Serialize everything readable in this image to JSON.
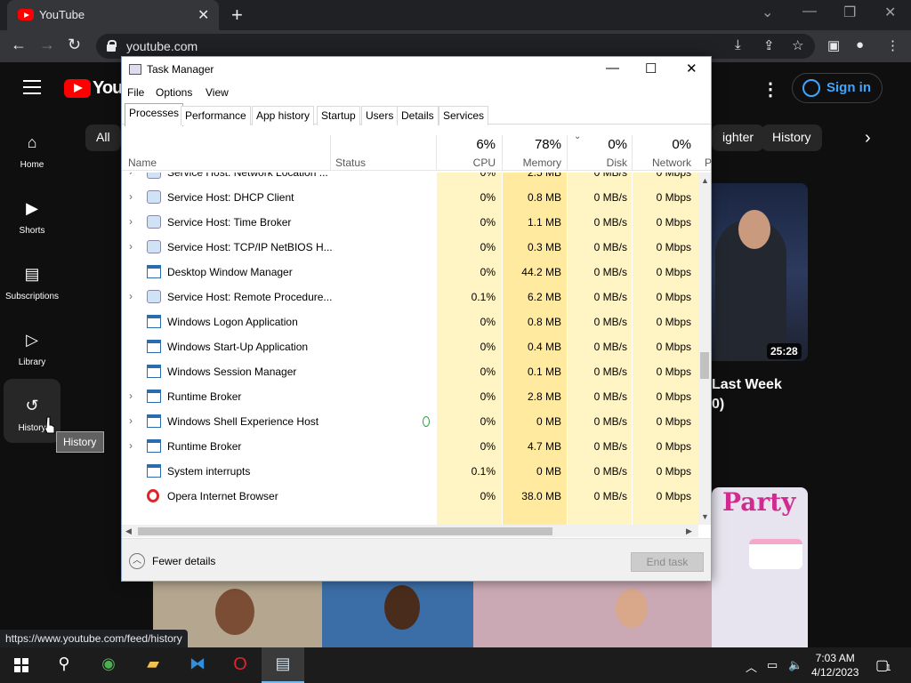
{
  "browser": {
    "tab_title": "YouTube",
    "url": "youtube.com",
    "status_url": "https://www.youtube.com/feed/history"
  },
  "youtube": {
    "wordmark": "YouT",
    "signin_label": "Sign in",
    "sidebar": [
      {
        "label": "Home",
        "icon": "home-icon"
      },
      {
        "label": "Shorts",
        "icon": "shorts-icon"
      },
      {
        "label": "Subscriptions",
        "icon": "subscriptions-icon"
      },
      {
        "label": "Library",
        "icon": "library-icon"
      },
      {
        "label": "History",
        "icon": "history-icon"
      }
    ],
    "tooltip": "History",
    "chips": [
      "All",
      "ighter",
      "History"
    ],
    "video": {
      "duration": "25:28",
      "title_line1": "Last Week",
      "title_line2": "0)"
    },
    "thumb_text": "Party"
  },
  "taskmanager": {
    "title": "Task Manager",
    "menu": [
      "File",
      "Options",
      "View"
    ],
    "tabs": [
      "Processes",
      "Performance",
      "App history",
      "Startup",
      "Users",
      "Details",
      "Services"
    ],
    "active_tab": "Processes",
    "columns": {
      "name": "Name",
      "status": "Status",
      "cpu": {
        "pct": "6%",
        "label": "CPU"
      },
      "memory": {
        "pct": "78%",
        "label": "Memory"
      },
      "disk": {
        "pct": "0%",
        "label": "Disk"
      },
      "network": {
        "pct": "0%",
        "label": "Network"
      },
      "power": "P"
    },
    "rows": [
      {
        "name": "Service Host: Network Location ...",
        "expand": true,
        "icon": "gear",
        "cpu": "0%",
        "mem": "2.5 MB",
        "disk": "0 MB/s",
        "net": "0 Mbps"
      },
      {
        "name": "Service Host: DHCP Client",
        "expand": true,
        "icon": "gear",
        "cpu": "0%",
        "mem": "0.8 MB",
        "disk": "0 MB/s",
        "net": "0 Mbps"
      },
      {
        "name": "Service Host: Time Broker",
        "expand": true,
        "icon": "gear",
        "cpu": "0%",
        "mem": "1.1 MB",
        "disk": "0 MB/s",
        "net": "0 Mbps"
      },
      {
        "name": "Service Host: TCP/IP NetBIOS H...",
        "expand": true,
        "icon": "gear",
        "cpu": "0%",
        "mem": "0.3 MB",
        "disk": "0 MB/s",
        "net": "0 Mbps"
      },
      {
        "name": "Desktop Window Manager",
        "expand": false,
        "icon": "win",
        "cpu": "0%",
        "mem": "44.2 MB",
        "disk": "0 MB/s",
        "net": "0 Mbps"
      },
      {
        "name": "Service Host: Remote Procedure...",
        "expand": true,
        "icon": "gear",
        "cpu": "0.1%",
        "mem": "6.2 MB",
        "disk": "0 MB/s",
        "net": "0 Mbps"
      },
      {
        "name": "Windows Logon Application",
        "expand": false,
        "icon": "win",
        "cpu": "0%",
        "mem": "0.8 MB",
        "disk": "0 MB/s",
        "net": "0 Mbps"
      },
      {
        "name": "Windows Start-Up Application",
        "expand": false,
        "icon": "win",
        "cpu": "0%",
        "mem": "0.4 MB",
        "disk": "0 MB/s",
        "net": "0 Mbps"
      },
      {
        "name": "Windows Session Manager",
        "expand": false,
        "icon": "win",
        "cpu": "0%",
        "mem": "0.1 MB",
        "disk": "0 MB/s",
        "net": "0 Mbps"
      },
      {
        "name": "Runtime Broker",
        "expand": true,
        "icon": "win",
        "cpu": "0%",
        "mem": "2.8 MB",
        "disk": "0 MB/s",
        "net": "0 Mbps"
      },
      {
        "name": "Windows Shell Experience Host",
        "expand": true,
        "icon": "win",
        "cpu": "0%",
        "mem": "0 MB",
        "disk": "0 MB/s",
        "net": "0 Mbps",
        "leaf": true
      },
      {
        "name": "Runtime Broker",
        "expand": true,
        "icon": "win",
        "cpu": "0%",
        "mem": "4.7 MB",
        "disk": "0 MB/s",
        "net": "0 Mbps"
      },
      {
        "name": "System interrupts",
        "expand": false,
        "icon": "win",
        "cpu": "0.1%",
        "mem": "0 MB",
        "disk": "0 MB/s",
        "net": "0 Mbps"
      },
      {
        "name": "Opera Internet Browser",
        "expand": false,
        "icon": "opera",
        "cpu": "0%",
        "mem": "38.0 MB",
        "disk": "0 MB/s",
        "net": "0 Mbps"
      }
    ],
    "fewer_details": "Fewer details",
    "end_task": "End task"
  },
  "taskbar": {
    "time": "7:03 AM",
    "date": "4/12/2023",
    "notif_count": "1"
  },
  "colors": {
    "cpu_bg": "#fff4c4",
    "mem_bg": "#ffeaa0",
    "cell_bg": "#fff9e0"
  }
}
